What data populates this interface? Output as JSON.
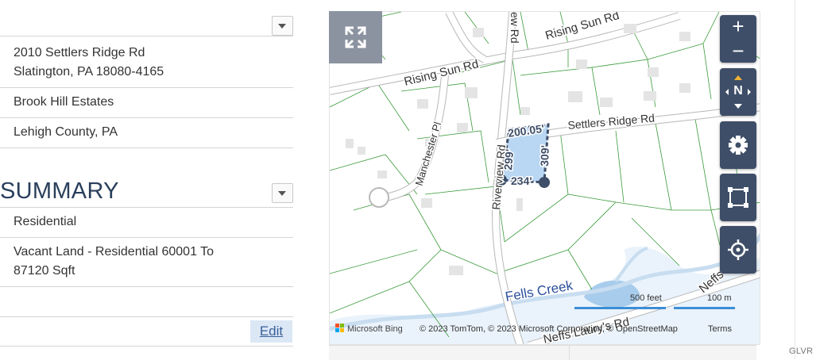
{
  "details": {
    "address_line1": "2010 Settlers Ridge Rd",
    "address_line2": "Slatington, PA 18080-4165",
    "subdivision": "Brook Hill Estates",
    "county": "Lehigh County, PA"
  },
  "summary": {
    "heading": "SUMMARY",
    "property_type": "Residential",
    "property_subtype_line1": "Vacant Land - Residential 60001 To",
    "property_subtype_line2": "87120 Sqft",
    "edit_label": "Edit"
  },
  "map": {
    "roads": {
      "rising_sun_upper": "Rising Sun Rd",
      "rising_sun_lower": "Rising Sun Rd",
      "view_rd": "ew Rd",
      "manchester": "Manchester Pl",
      "settlers_ridge": "Settlers Ridge Rd",
      "riverview": "Riverview Rd",
      "fells_creek": "Fells Creek",
      "neffs_laury": "Neffs Laury's Rd",
      "neffs": "Neffs"
    },
    "dimensions": {
      "top": "200.05'",
      "left": "299'",
      "right": "309'",
      "bottom": "234'"
    },
    "scale": {
      "feet": "500 feet",
      "meters": "100 m"
    },
    "attribution": {
      "brand": "Microsoft Bing",
      "copyright": "© 2023 TomTom, © 2023 Microsoft Corporation, © OpenStreetMap",
      "terms": "Terms"
    },
    "controls": {
      "zoom_in": "+",
      "zoom_out": "−",
      "compass": "N"
    },
    "colors": {
      "lot_fill": "#b9d7f2",
      "lot_outline": "#3e4e68",
      "parcel_lines": "#3a9a3a",
      "water": "#a8ccec",
      "control_bg": "#3e4e68",
      "scale_bar": "#3b8ed6"
    }
  },
  "footer": {
    "mark": "GLVR"
  }
}
